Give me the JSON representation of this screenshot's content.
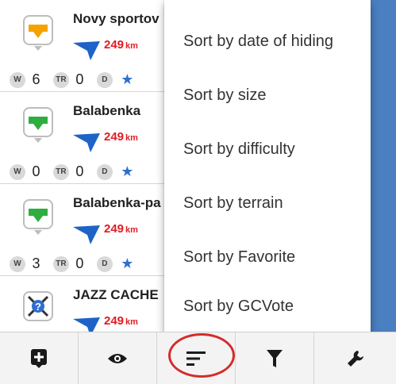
{
  "cache_list": {
    "items": [
      {
        "title": "Novy sportov",
        "distance": "249",
        "unit": "km",
        "w": "6",
        "tr": "0",
        "icon": "cache-traditional-icon"
      },
      {
        "title": "Balabenka",
        "distance": "249",
        "unit": "km",
        "w": "0",
        "tr": "0",
        "icon": "cache-traditional-icon"
      },
      {
        "title": "Balabenka-pa",
        "distance": "249",
        "unit": "km",
        "w": "3",
        "tr": "0",
        "icon": "cache-traditional-icon"
      },
      {
        "title": "JAZZ CACHE",
        "distance": "249",
        "unit": "km",
        "w": "",
        "tr": "",
        "icon": "cache-mystery-icon"
      }
    ],
    "badges": {
      "w": "W",
      "tr": "TR",
      "d": "D"
    },
    "star": "★"
  },
  "sort_menu": {
    "items": [
      "Sort by date of hiding",
      "Sort by size",
      "Sort by difficulty",
      "Sort by terrain",
      "Sort by Favorite",
      "Sort by GCVote"
    ]
  },
  "bottom_toolbar": {
    "buttons": [
      "add-cache-icon",
      "eye-icon",
      "sort-icon",
      "filter-icon",
      "wrench-icon"
    ],
    "highlighted": "sort-icon"
  },
  "colors": {
    "accent_blue": "#4a7fc1",
    "distance_red": "#e01b24",
    "arrow_blue": "#1e63c6",
    "highlight_ring": "#d62b2b"
  }
}
